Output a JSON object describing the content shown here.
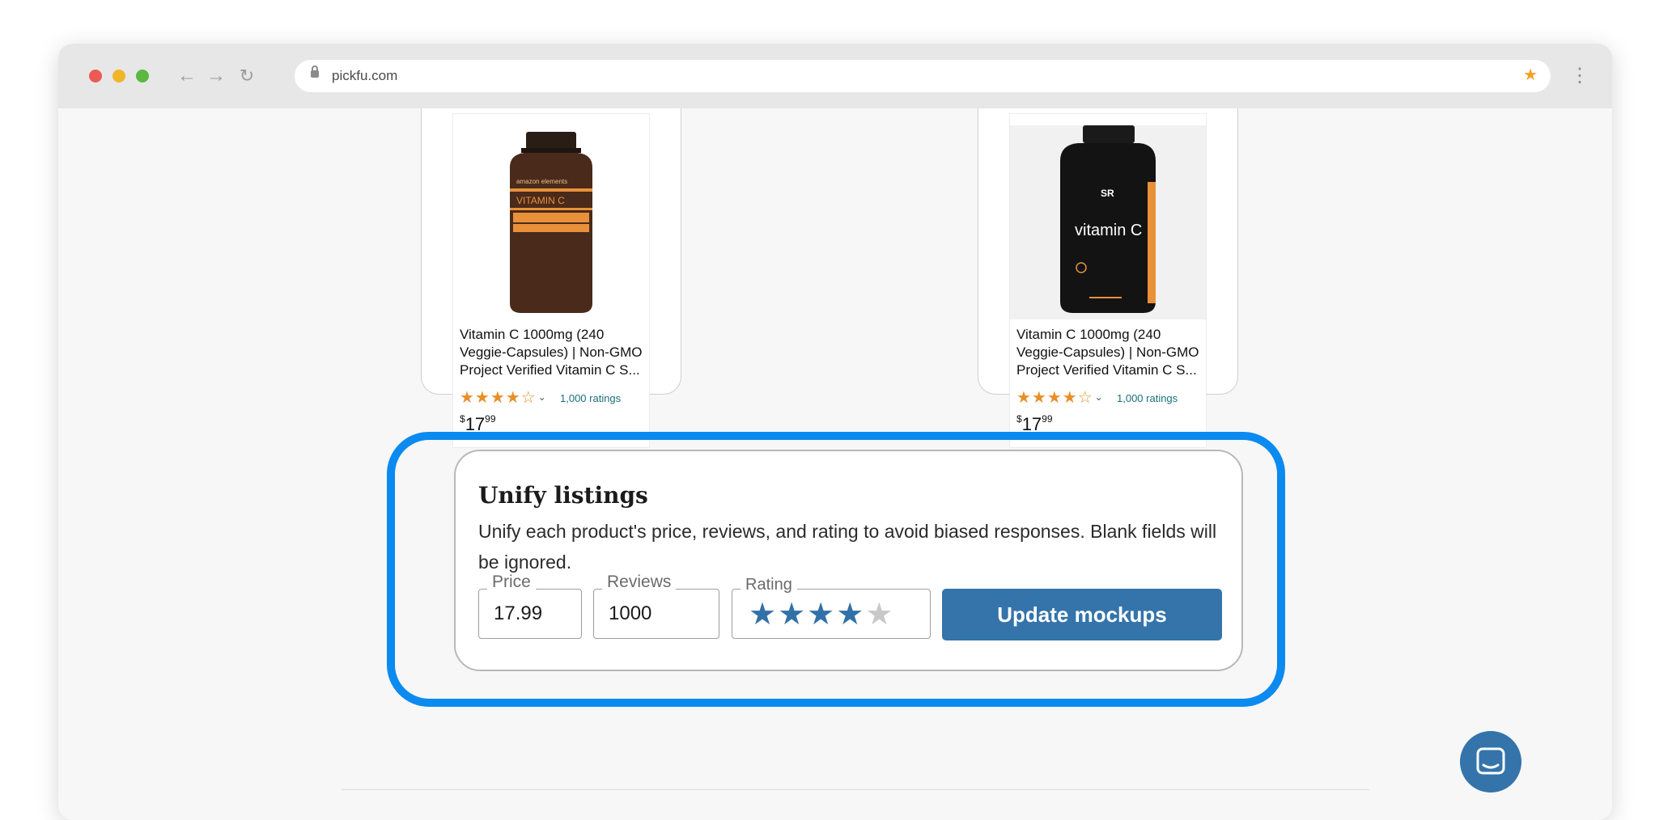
{
  "browser": {
    "url": "pickfu.com",
    "controls": {
      "back_icon": "arrow-left-icon",
      "forward_icon": "arrow-right-icon",
      "reload_icon": "reload-icon",
      "bookmark_icon": "star-icon",
      "menu_icon": "kebab-icon"
    }
  },
  "products": [
    {
      "title": "Vitamin C 1000mg (240 Veggie-Capsules) | Non-GMO Project Verified Vitamin C S...",
      "stars_text": "★★★★☆",
      "ratings": "1,000 ratings",
      "price_currency": "$",
      "price_whole": "17",
      "price_fraction": "99",
      "bottle_brand": "amazon elements",
      "bottle_label": "VITAMIN C"
    },
    {
      "title": "Vitamin C 1000mg (240 Veggie-Capsules) | Non-GMO Project Verified Vitamin C S...",
      "stars_text": "★★★★☆",
      "ratings": "1,000 ratings",
      "price_currency": "$",
      "price_whole": "17",
      "price_fraction": "99",
      "bottle_brand": "SR",
      "bottle_label": "vitamin C"
    }
  ],
  "unify": {
    "title": "Unify listings",
    "description": "Unify each product's price, reviews, and rating to avoid biased responses. Blank fields will be ignored.",
    "price_label": "Price",
    "price_value": "17.99",
    "reviews_label": "Reviews",
    "reviews_value": "1000",
    "rating_label": "Rating",
    "rating_value": 4,
    "rating_max": 5,
    "update_button": "Update mockups"
  },
  "colors": {
    "highlight": "#0b8aef",
    "primary": "#3474aa",
    "rating_star": "#e88f28"
  },
  "chat": {
    "icon": "chat-icon"
  }
}
